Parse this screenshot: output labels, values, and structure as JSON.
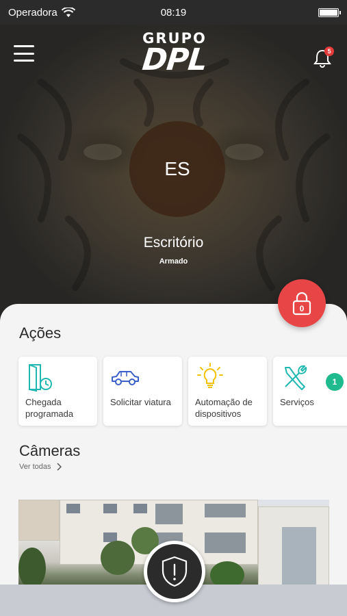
{
  "statusbar": {
    "carrier": "Operadora",
    "time": "08:19"
  },
  "header": {
    "logo_line1": "GRUPO",
    "logo_line2": "DPL",
    "notification_count": "5"
  },
  "site": {
    "initials": "ES",
    "name": "Escritório",
    "status": "Armado"
  },
  "lock_button": {
    "count": "0"
  },
  "actions": {
    "title": "Ações",
    "badge": "1",
    "items": [
      {
        "label": "Chegada programada",
        "icon": "door-clock-icon"
      },
      {
        "label": "Solicitar viatura",
        "icon": "car-icon"
      },
      {
        "label": "Automação de dispositivos",
        "icon": "lightbulb-icon"
      },
      {
        "label": "Serviços",
        "icon": "tools-icon"
      }
    ]
  },
  "cameras": {
    "title": "Câmeras",
    "see_all": "Ver todas"
  },
  "colors": {
    "accent_red": "#e84646",
    "accent_green": "#1fba8e",
    "icon_blue": "#3a5fc8",
    "icon_teal": "#1fb8b0",
    "icon_yellow": "#f2c200"
  }
}
